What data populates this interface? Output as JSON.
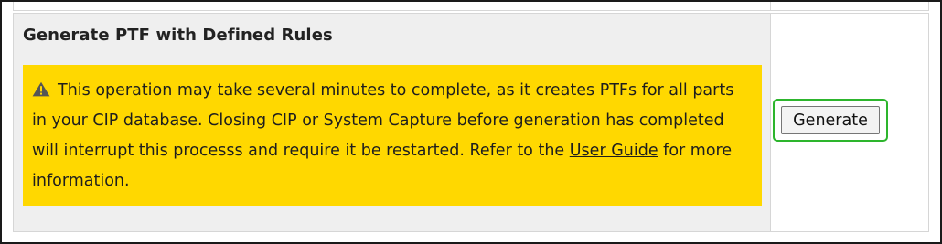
{
  "section": {
    "title": "Generate PTF with Defined Rules"
  },
  "warning": {
    "icon": "warning-icon",
    "text_before_link": "This operation may take several minutes to complete, as it creates PTFs for all parts in your CIP database. Closing CIP or System Capture before generation has completed will interrupt this processs and require it be restarted. Refer to the ",
    "link_label": "User Guide",
    "text_after_link": " for more information.",
    "background_color": "#ffd800"
  },
  "actions": {
    "generate_label": "Generate",
    "focus_ring_color": "#2db52d"
  }
}
